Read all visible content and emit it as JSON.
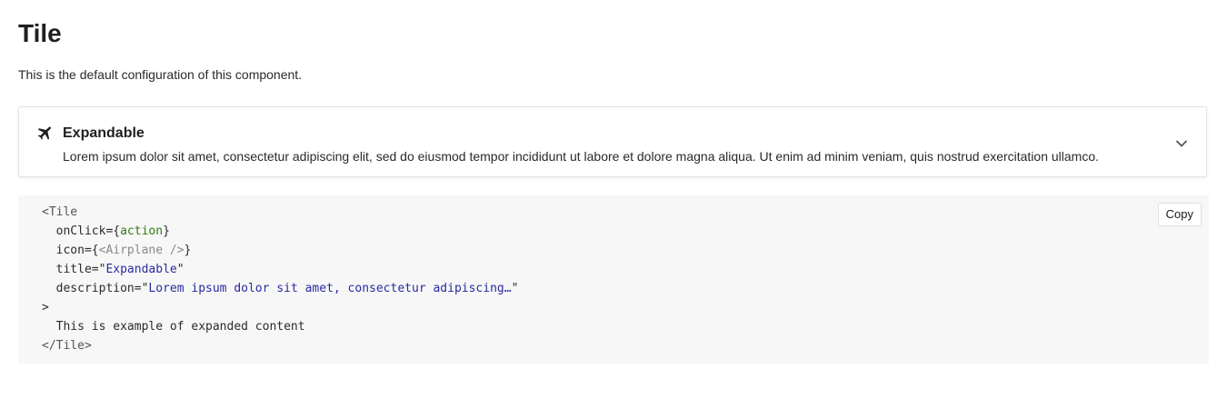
{
  "page": {
    "title": "Tile",
    "subtitle": "This is the default configuration of this component."
  },
  "tile": {
    "icon": "airplane-icon",
    "title": "Expandable",
    "description": "Lorem ipsum dolor sit amet, consectetur adipiscing elit, sed do eiusmod tempor incididunt ut labore et dolore magna aliqua. Ut enim ad minim veniam, quis nostrud exercitation ullamco.",
    "toggle_icon": "chevron-down-icon"
  },
  "code": {
    "copy_label": "Copy",
    "open_tag": "<Tile",
    "onclick_attr": "onClick=",
    "onclick_open": "{",
    "onclick_value": "action",
    "onclick_close": "}",
    "icon_attr": "icon=",
    "icon_open": "{",
    "icon_value": "<Airplane />",
    "icon_close": "}",
    "title_attr": "title=",
    "title_quote_open": "\"",
    "title_value": "Expandable",
    "title_quote_close": "\"",
    "desc_attr": "description=",
    "desc_quote_open": "\"",
    "desc_value": "Lorem ipsum dolor sit amet, consectetur adipiscing…",
    "desc_quote_close": "\"",
    "gt": ">",
    "child_text": "This is example of expanded content",
    "close_tag": "</Tile>"
  },
  "colors": {
    "code_bg": "#f7f7f7",
    "expression": "#2e7d0f",
    "string": "#2a2aa0",
    "component_ref": "#8a8a8a"
  }
}
